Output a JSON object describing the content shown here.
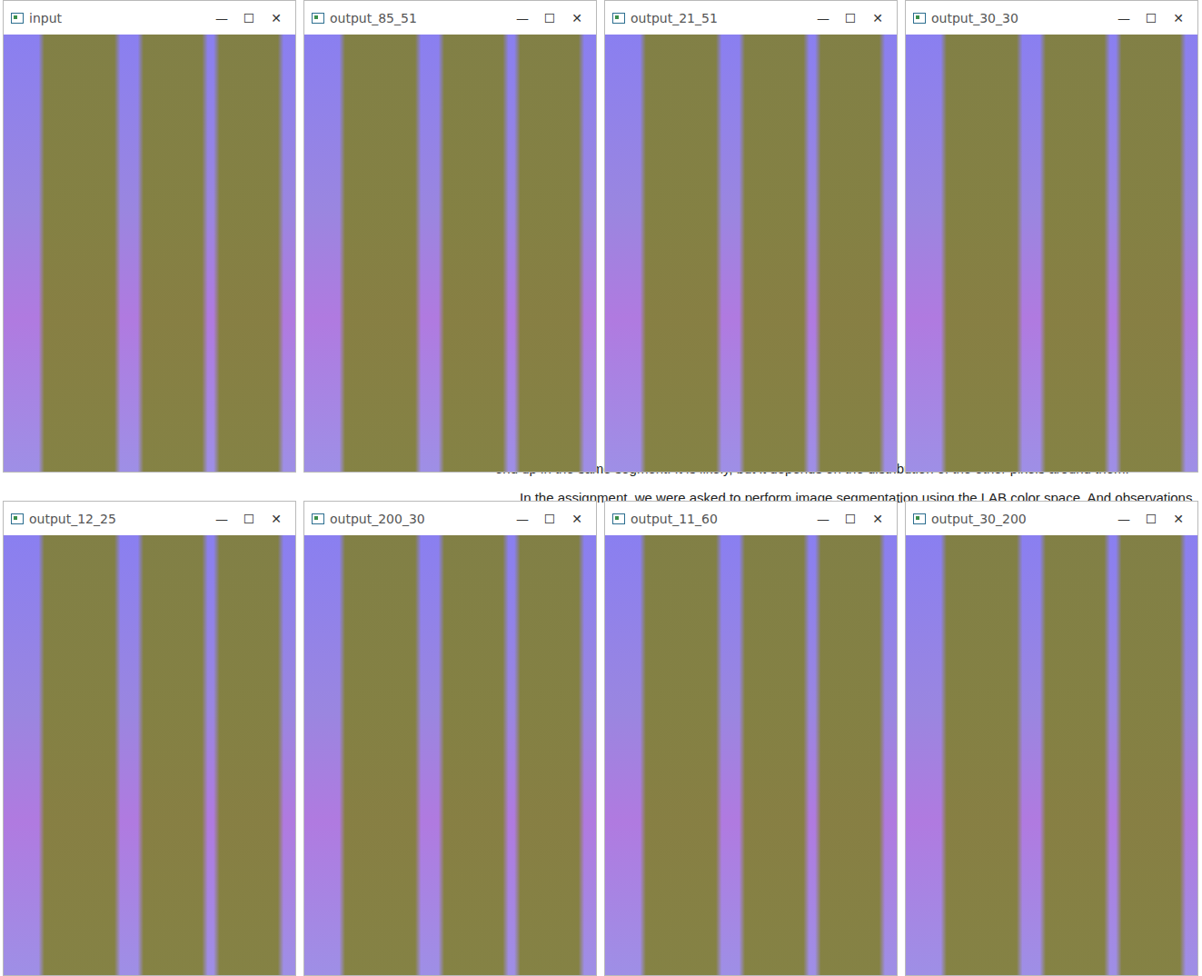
{
  "desktop": {
    "document_lines": [
      "end up in the same segment. It is likely, but it depends on the distribution of the other pixels around them.",
      "In the assignment, we were asked to perform image segmentation using the LAB color space. And observations"
    ]
  },
  "controls": [
    "—",
    "☐",
    "✕"
  ],
  "windows": [
    {
      "title": "input"
    },
    {
      "title": "output_85_51"
    },
    {
      "title": "output_21_51"
    },
    {
      "title": "output_30_30"
    },
    {
      "title": "output_12_25"
    },
    {
      "title": "output_200_30"
    },
    {
      "title": "output_11_60"
    },
    {
      "title": "output_30_200"
    }
  ]
}
